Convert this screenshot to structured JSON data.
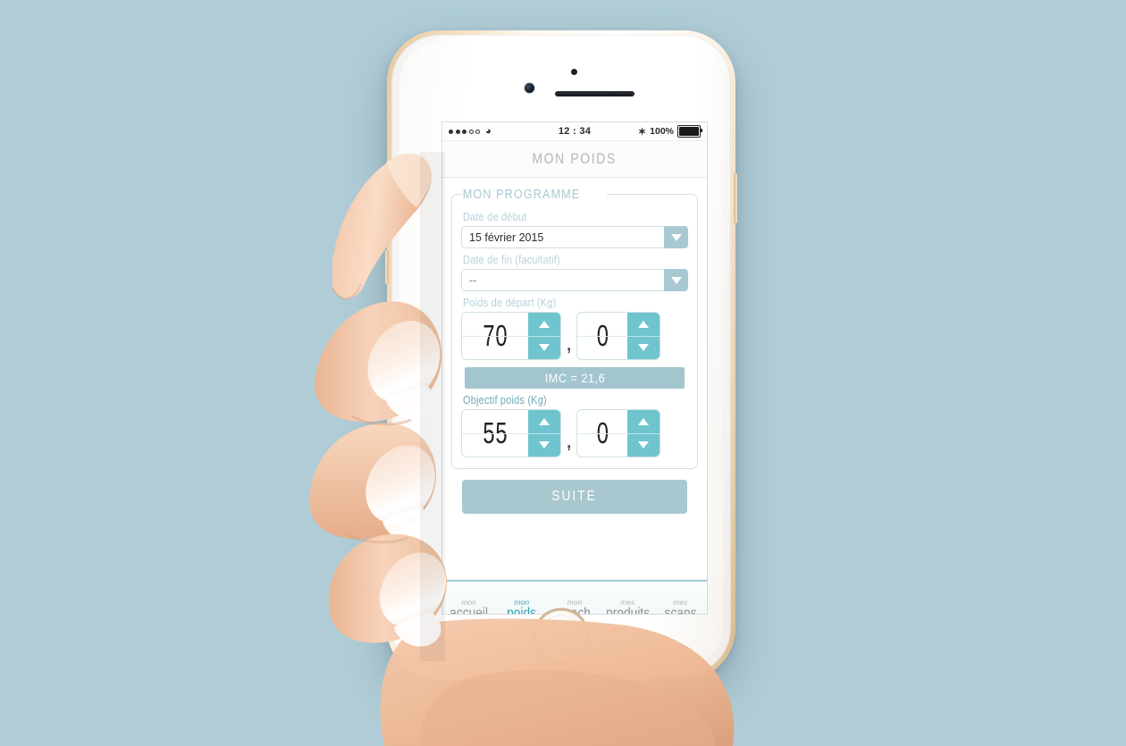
{
  "background_color": "#b0cdd7",
  "device": {
    "name": "smartphone-mockup",
    "frame_color": "#e3c49c",
    "body_color": "#ffffff"
  },
  "status_bar": {
    "carrier_dots_filled": 3,
    "carrier_dots_total": 5,
    "wifi_icon": "wifi-icon",
    "time": "12 : 34",
    "bluetooth_icon": "bluetooth-icon",
    "battery_percent": "100%",
    "battery_icon": "battery-full-icon"
  },
  "navbar": {
    "title": "MON POIDS"
  },
  "form": {
    "legend": "MON PROGRAMME",
    "start_date": {
      "label": "Date de début",
      "value": "15 février 2015",
      "arrow_icon": "chevron-down-icon"
    },
    "end_date": {
      "label": "Date de fin (facultatif)",
      "value": "--",
      "arrow_icon": "chevron-down-icon"
    },
    "start_weight": {
      "label": "Poids de départ (Kg)",
      "integer": "70",
      "decimal": "0",
      "separator": ",",
      "up_icon": "chevron-up-icon",
      "down_icon": "chevron-down-icon"
    },
    "imc": {
      "text": "IMC = 21,6",
      "color": "#a3c5ce"
    },
    "goal_weight": {
      "label": "Objectif poids (Kg)",
      "integer": "55",
      "decimal": "0",
      "separator": ",",
      "up_icon": "chevron-up-icon",
      "down_icon": "chevron-down-icon"
    }
  },
  "primary_button": {
    "label": "SUITE",
    "color": "#a8c7cf"
  },
  "tabbar": {
    "active_color": "#2e9fb4",
    "inactive_color": "#8f8f8f",
    "tabs": [
      {
        "small": "mon",
        "big": "accueil",
        "active": false
      },
      {
        "small": "mon",
        "big": "poids",
        "active": true
      },
      {
        "small": "mon",
        "big": "coach",
        "active": false
      },
      {
        "small": "mes",
        "big": "produits",
        "active": false
      },
      {
        "small": "mes",
        "big": "scans",
        "active": false
      }
    ]
  },
  "accents": {
    "stepper_teal": "#6fc4ce",
    "dropdown_blue": "#a8c8d2",
    "border_blue": "#cfe0e6",
    "label_blue": "#b9d2da"
  }
}
